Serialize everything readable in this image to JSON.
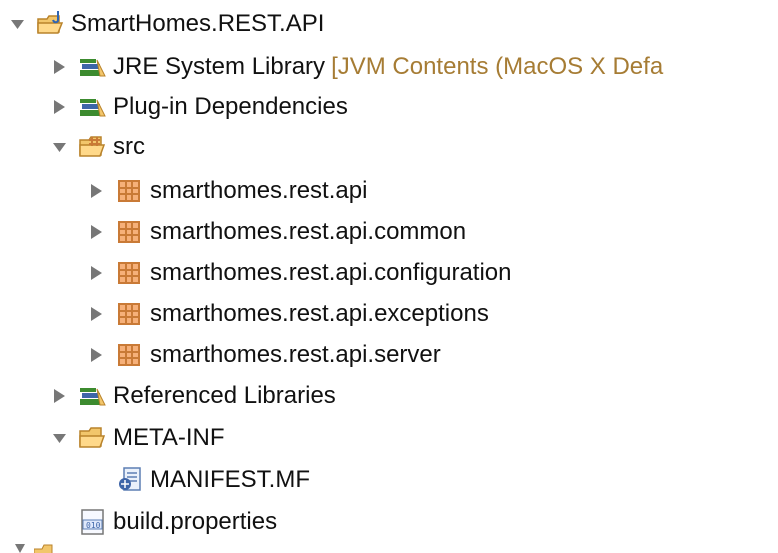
{
  "tree": {
    "root": {
      "label": "SmartHomes.REST.API",
      "icon": "java-project-icon",
      "expanded": true
    },
    "items": [
      {
        "label": "JRE System Library",
        "decoration": "[JVM Contents (MacOS X Defa",
        "icon": "library-icon",
        "expanded": false
      },
      {
        "label": "Plug-in Dependencies",
        "icon": "library-icon",
        "expanded": false
      },
      {
        "label": "src",
        "icon": "source-folder-icon",
        "expanded": true
      },
      {
        "label": "smarthomes.rest.api",
        "icon": "package-icon",
        "expanded": false
      },
      {
        "label": "smarthomes.rest.api.common",
        "icon": "package-icon",
        "expanded": false
      },
      {
        "label": "smarthomes.rest.api.configuration",
        "icon": "package-icon",
        "expanded": false
      },
      {
        "label": "smarthomes.rest.api.exceptions",
        "icon": "package-icon",
        "expanded": false
      },
      {
        "label": "smarthomes.rest.api.server",
        "icon": "package-icon",
        "expanded": false
      },
      {
        "label": "Referenced Libraries",
        "icon": "library-icon",
        "expanded": false
      },
      {
        "label": "META-INF",
        "icon": "folder-icon",
        "expanded": true
      },
      {
        "label": "MANIFEST.MF",
        "icon": "manifest-file-icon"
      },
      {
        "label": "build.properties",
        "icon": "properties-file-icon"
      }
    ]
  },
  "colors": {
    "text": "#111111",
    "decoration": "#a67c34",
    "twisty": "#777777",
    "folder": "#f2c66b",
    "package": "#c97a36",
    "library_green": "#3c8b2f",
    "library_blue": "#3e65a8"
  }
}
